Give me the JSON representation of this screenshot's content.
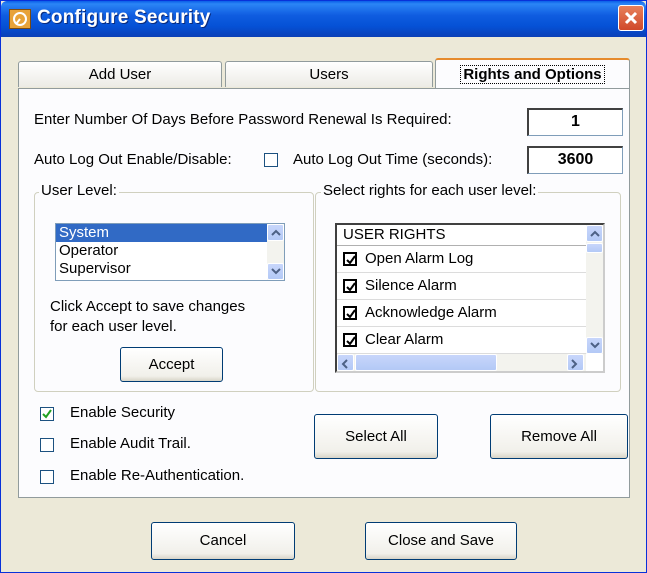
{
  "window": {
    "title": "Configure Security"
  },
  "tabs": [
    {
      "label": "Add User"
    },
    {
      "label": "Users"
    },
    {
      "label": "Rights and Options"
    }
  ],
  "password_renewal": {
    "label": "Enter Number Of Days Before Password Renewal Is Required:",
    "value": "1"
  },
  "auto_logout": {
    "enable_label": "Auto Log Out Enable/Disable:",
    "enabled": false,
    "time_label": "Auto Log Out Time (seconds):",
    "time_value": "3600"
  },
  "user_level": {
    "group_label": "User Level:",
    "items": [
      "System",
      "Operator",
      "Supervisor"
    ],
    "selected": "System",
    "hint_line1": "Click Accept to save changes",
    "hint_line2": "for each user level.",
    "accept_label": "Accept"
  },
  "rights": {
    "group_label": "Select rights for each user level:",
    "header": "USER RIGHTS",
    "items": [
      {
        "label": "Open Alarm Log",
        "checked": true
      },
      {
        "label": "Silence Alarm",
        "checked": true
      },
      {
        "label": "Acknowledge Alarm",
        "checked": true
      },
      {
        "label": "Clear Alarm",
        "checked": true
      }
    ]
  },
  "options": [
    {
      "label": "Enable Security",
      "checked": true
    },
    {
      "label": "Enable Audit Trail.",
      "checked": false
    },
    {
      "label": "Enable Re-Authentication.",
      "checked": false
    }
  ],
  "buttons": {
    "select_all": "Select All",
    "remove_all": "Remove All",
    "cancel": "Cancel",
    "close_and_save": "Close and Save"
  }
}
